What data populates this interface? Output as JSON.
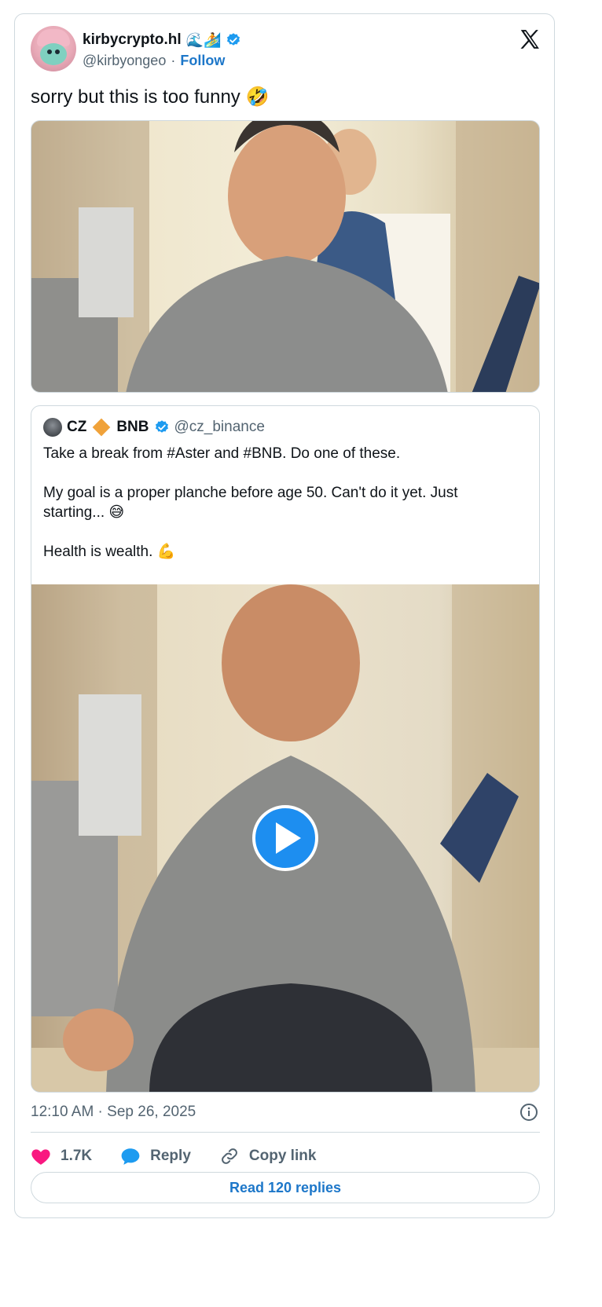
{
  "author": {
    "display_name": "kirbycrypto.hl",
    "emoji": "🌊🏄",
    "handle": "@kirbyongeo",
    "separator": "·",
    "follow_label": "Follow"
  },
  "tweet": {
    "text": "sorry but this is too funny 🤣"
  },
  "quoted": {
    "name": "CZ",
    "name_suffix": "BNB",
    "handle": "@cz_binance",
    "text": "Take a break from #Aster and #BNB. Do one of these.\n\nMy goal is a proper planche before age 50. Can't do it yet. Just starting... 😅\n\nHealth is wealth. 💪"
  },
  "meta": {
    "timestamp": "12:10 AM · Sep 26, 2025"
  },
  "actions": {
    "likes": "1.7K",
    "reply_label": "Reply",
    "copy_label": "Copy link",
    "read_replies": "Read 120 replies"
  },
  "colors": {
    "accent": "#1d77c9",
    "heart": "#f91880",
    "verified": "#1d9bf0",
    "diamond": "#f0a23a"
  },
  "icons": [
    "x-logo-icon",
    "verified-badge-icon",
    "play-icon",
    "info-icon",
    "heart-icon",
    "reply-bubble-icon",
    "link-icon"
  ]
}
